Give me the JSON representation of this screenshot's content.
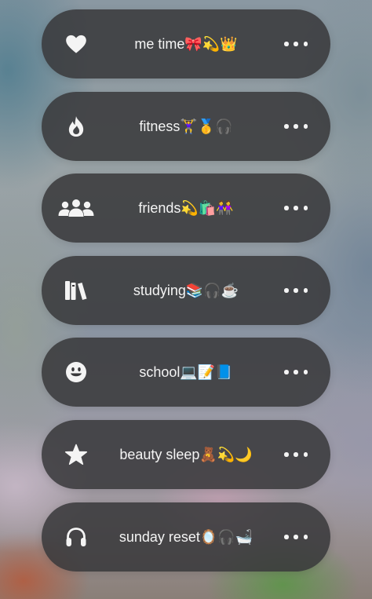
{
  "focus_modes": [
    {
      "label": "me time🎀💫👑",
      "icon": "heart-icon"
    },
    {
      "label": "fitness🏋️‍♀️🥇🎧",
      "icon": "flame-icon"
    },
    {
      "label": "friends💫🛍️👭",
      "icon": "people-icon"
    },
    {
      "label": "studying📚🎧☕",
      "icon": "books-icon"
    },
    {
      "label": "school💻📝📘",
      "icon": "smiley-icon"
    },
    {
      "label": "beauty sleep🧸💫🌙",
      "icon": "star-icon"
    },
    {
      "label": "sunday reset🪞🎧🛁",
      "icon": "headphones-icon"
    }
  ],
  "colors": {
    "pill_background": "#38383a",
    "text": "#f4f4f4"
  }
}
